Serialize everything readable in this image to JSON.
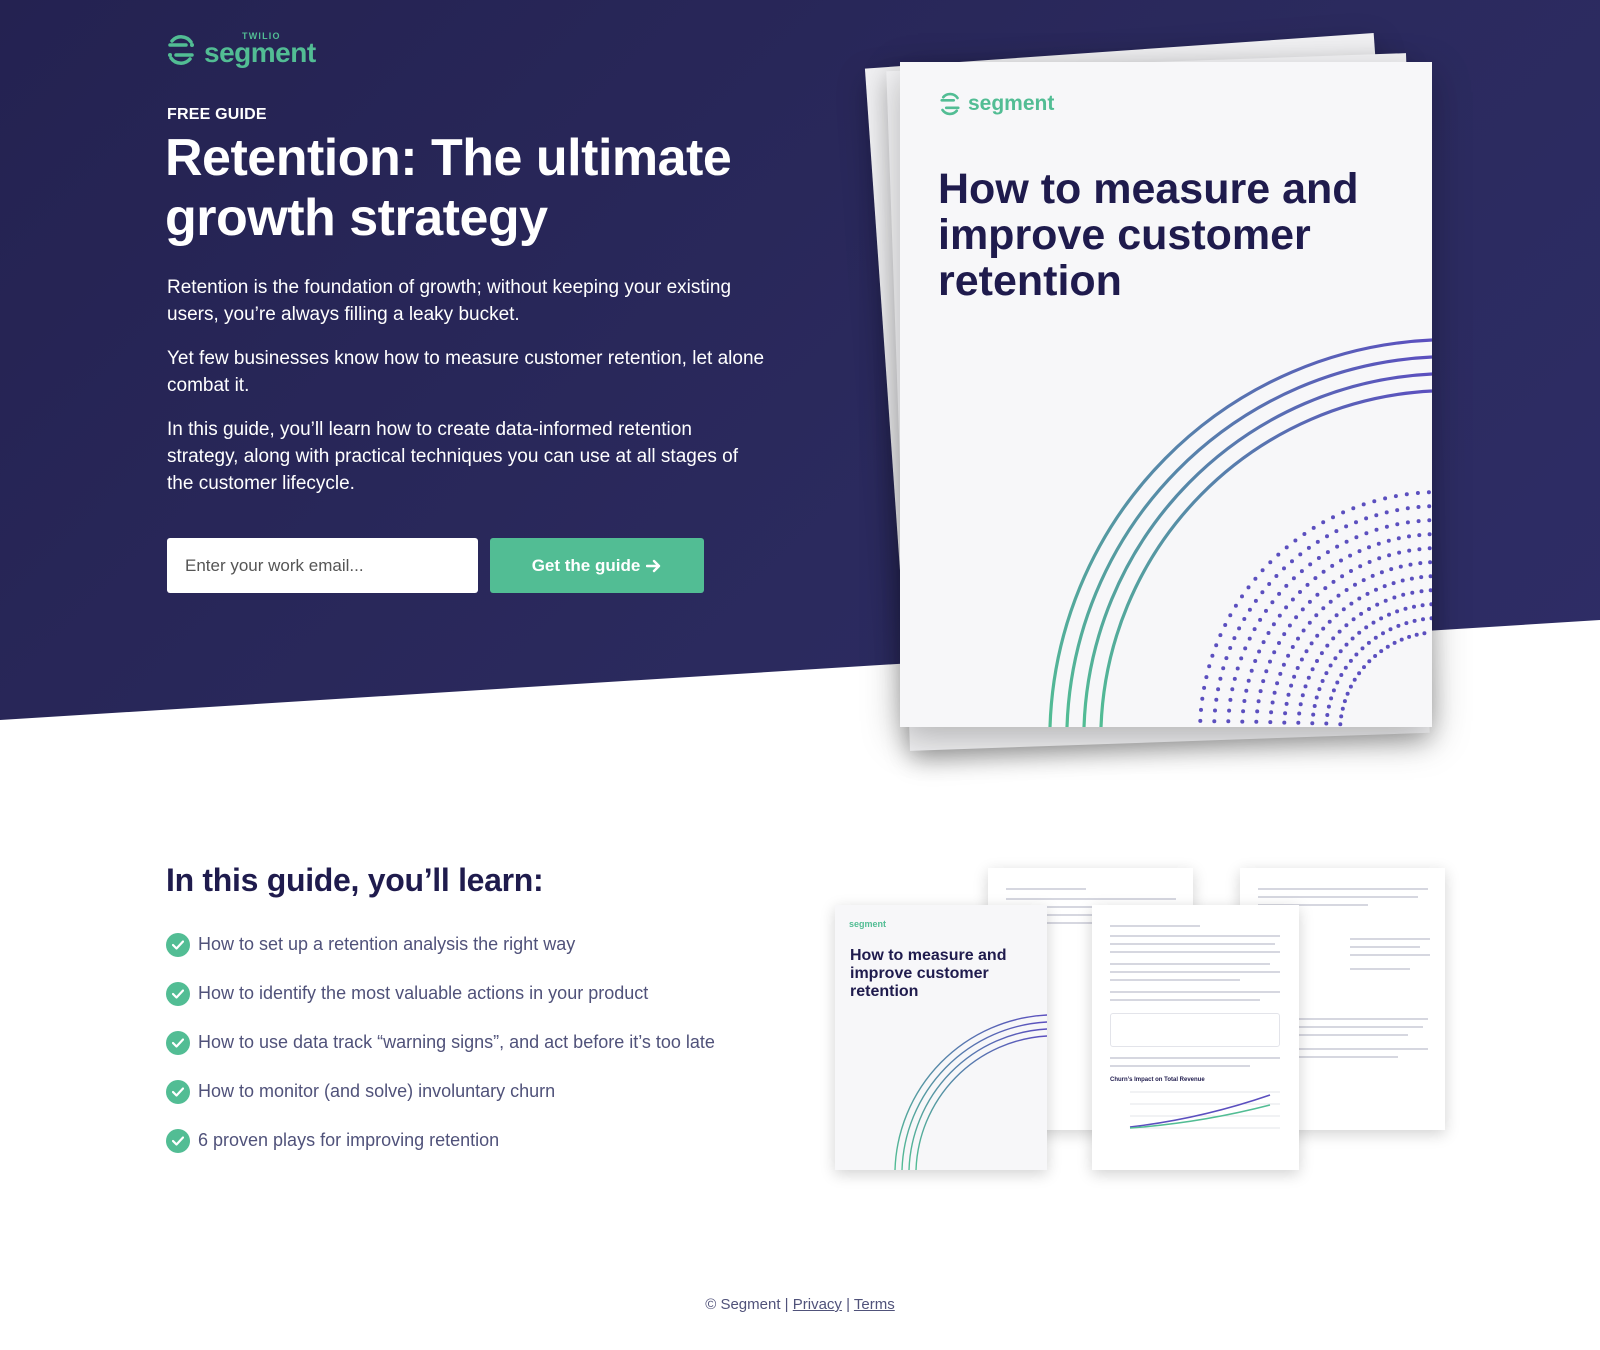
{
  "brand": {
    "twilio": "TWILIO",
    "name": "segment",
    "accent": "#52bd94",
    "navy": "#242251"
  },
  "hero": {
    "eyebrow": "FREE GUIDE",
    "title": "Retention: The ultimate growth strategy",
    "paragraphs": [
      "Retention is the foundation of growth; without keeping your existing users, you’re always filling a leaky bucket.",
      "Yet few businesses know how to measure customer retention, let alone combat it.",
      "In this guide, you’ll learn how to create data-informed retention strategy, along with practical techniques you can use at all stages of the customer lifecycle."
    ],
    "email_placeholder": "Enter your work email...",
    "cta_label": "Get the guide",
    "cta_icon": "arrow-right-icon"
  },
  "cover": {
    "logo": "segment",
    "title": "How to measure and improve customer retention"
  },
  "learn": {
    "title": "In this guide, you’ll learn:",
    "items": [
      "How to set up a retention analysis the right way",
      "How to identify the most valuable actions in your product",
      "How to use data track “warning signs”, and act before it’s too late",
      "How to monitor (and solve) involuntary churn",
      "6 proven plays for improving retention"
    ]
  },
  "preview": {
    "logo": "segment",
    "title": "How to measure and improve customer retention",
    "chart_label": "Churn’s Impact on Total Revenue"
  },
  "footer": {
    "copyright": "© Segment",
    "separator": "|",
    "privacy": "Privacy",
    "terms": "Terms"
  }
}
